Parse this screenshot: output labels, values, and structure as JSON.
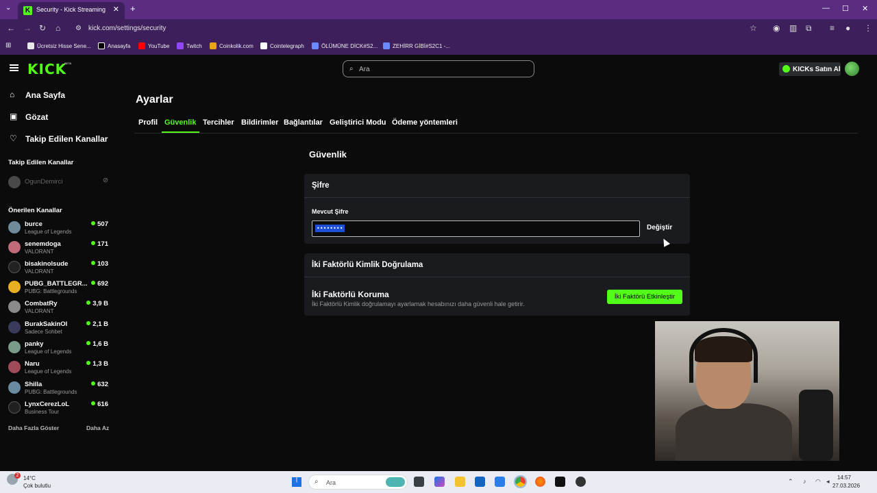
{
  "browser": {
    "tab_title": "Security - Kick Streaming",
    "url": "kick.com/settings/security",
    "bookmarks": [
      {
        "label": "Ücretsiz Hisse Sene...",
        "color": "#e8e8e8"
      },
      {
        "label": "Anasayfa",
        "color": "#000000"
      },
      {
        "label": "YouTube",
        "color": "#ff0000"
      },
      {
        "label": "Twitch",
        "color": "#9146ff"
      },
      {
        "label": "Coinkolik.com",
        "color": "#e8a317"
      },
      {
        "label": "Cointelegraph",
        "color": "#ffffff"
      },
      {
        "label": "ÖLÜMÜNE DİCK#S2...",
        "color": "#6a8bff"
      },
      {
        "label": "ZEHİRR GİBİ#S2C1 -...",
        "color": "#6a8bff"
      }
    ]
  },
  "header": {
    "logo": "KICK",
    "logo_badge": "BETA",
    "search_placeholder": "Ara",
    "kicks_button": "KICKs Satın Al"
  },
  "sidebar": {
    "nav": [
      {
        "label": "Ana Sayfa",
        "icon": "home-icon"
      },
      {
        "label": "Gözat",
        "icon": "browse-icon"
      },
      {
        "label": "Takip Edilen Kanallar",
        "icon": "heart-icon"
      }
    ],
    "followed_heading": "Takip Edilen Kanallar",
    "followed": [
      {
        "name": "OgunDemirci"
      }
    ],
    "recommended_heading": "Önerilen Kanallar",
    "recommended": [
      {
        "name": "burce",
        "category": "League of Legends",
        "viewers": "507",
        "color": "#6f8a9a"
      },
      {
        "name": "senemdoga",
        "category": "VALORANT",
        "viewers": "171",
        "color": "#c06a7a"
      },
      {
        "name": "bisakinolsude",
        "category": "VALORANT",
        "viewers": "103",
        "color": "#222222"
      },
      {
        "name": "PUBG_BATTLEGR...",
        "category": "PUBG: Battlegrounds",
        "viewers": "692",
        "color": "#e8b020"
      },
      {
        "name": "CombatRy",
        "category": "VALORANT",
        "viewers": "3,9 B",
        "color": "#8a8a8a"
      },
      {
        "name": "BurakSakinOl",
        "category": "Sadece Sohbet",
        "viewers": "2,1 B",
        "color": "#3a3a5a"
      },
      {
        "name": "panky",
        "category": "League of Legends",
        "viewers": "1,6 B",
        "color": "#7a9a8a"
      },
      {
        "name": "Naru",
        "category": "League of Legends",
        "viewers": "1,3 B",
        "color": "#a04a5a"
      },
      {
        "name": "Shilla",
        "category": "PUBG: Battlegrounds",
        "viewers": "632",
        "color": "#6a8aa0"
      },
      {
        "name": "LynxCerezLoL",
        "category": "Business Tour",
        "viewers": "616",
        "color": "#202020"
      }
    ],
    "show_more": "Daha Fazla Göster",
    "show_less": "Daha Az"
  },
  "main": {
    "title": "Ayarlar",
    "tabs": [
      "Profil",
      "Güvenlik",
      "Tercihler",
      "Bildirimler",
      "Bağlantılar",
      "Geliştirici Modu",
      "Ödeme yöntemleri"
    ],
    "active_tab": "Güvenlik",
    "section_title": "Güvenlik",
    "password_card": {
      "title": "Şifre",
      "field_label": "Mevcut Şifre",
      "field_value": "••••••••",
      "change_button": "Değiştir"
    },
    "twofa_card": {
      "title": "İki Faktörlü Kimlik Doğrulama",
      "heading": "İki Faktörlü Koruma",
      "description": "İki Faktörlü Kimlik doğrulamayı ayarlamak hesabınızı daha güvenli hale getirir.",
      "enable_button": "İki Faktörü Etkinleştir"
    }
  },
  "taskbar": {
    "temperature": "14°C",
    "weather": "Çok bulutlu",
    "weather_badge": "2",
    "search_placeholder": "Ara",
    "time": "14:57",
    "date": "27.03.2026"
  },
  "colors": {
    "accent": "#53fc18",
    "browser_chrome": "#3d1f5c",
    "background": "#0b0b0c",
    "card": "#191b1f"
  }
}
